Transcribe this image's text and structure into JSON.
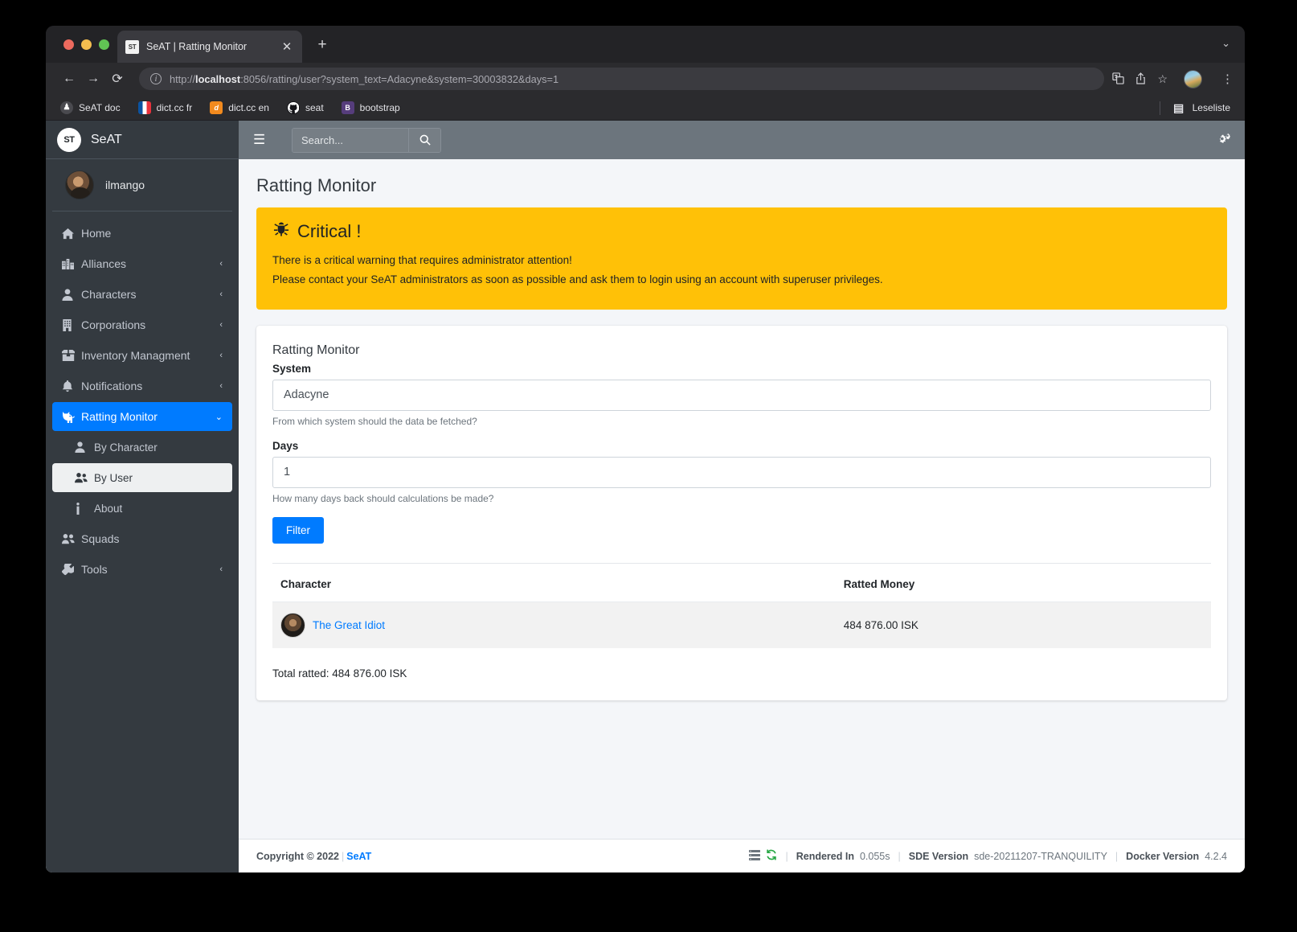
{
  "browser": {
    "tab": {
      "title": "SeAT | Ratting Monitor",
      "favicon_text": "ST",
      "close_icon": "✕"
    },
    "new_tab_icon": "+",
    "tab_menu_icon": "⌄",
    "back_icon": "←",
    "forward_icon": "→",
    "reload_icon": "⟳",
    "url_prefix": "http://",
    "url_host": "localhost",
    "url_rest": ":8056/ratting/user?system_text=Adacyne&system=30003832&days=1",
    "info_icon": "i",
    "translate_icon": "translate-icon",
    "share_icon": "⇪",
    "bookmark_icon": "☆",
    "kebab_icon": "⋮",
    "bookmarks": [
      {
        "label": "SeAT doc",
        "icon": "seat-icon",
        "glyph": "♟"
      },
      {
        "label": "dict.cc fr",
        "icon": "flag-fr-icon",
        "glyph": ""
      },
      {
        "label": "dict.cc en",
        "icon": "dict-icon",
        "glyph": "d"
      },
      {
        "label": "seat",
        "icon": "github-icon",
        "glyph": "◍"
      },
      {
        "label": "bootstrap",
        "icon": "bootstrap-icon",
        "glyph": "B"
      }
    ],
    "reading_list": {
      "label": "Leseliste",
      "icon": "reading-list-icon",
      "glyph": "▤"
    }
  },
  "sidebar": {
    "brand": {
      "logo_text": "ST",
      "name": "SeAT"
    },
    "user": {
      "name": "ilmango"
    },
    "items": [
      {
        "label": "Home",
        "icon": "home-icon",
        "glyph": "⌂",
        "arrow": "",
        "state": ""
      },
      {
        "label": "Alliances",
        "icon": "alliances-icon",
        "glyph": "🏙",
        "arrow": "‹",
        "state": ""
      },
      {
        "label": "Characters",
        "icon": "character-icon",
        "glyph": "👤",
        "arrow": "‹",
        "state": ""
      },
      {
        "label": "Corporations",
        "icon": "corporation-icon",
        "glyph": "🏢",
        "arrow": "‹",
        "state": ""
      },
      {
        "label": "Inventory Managment",
        "icon": "inventory-icon",
        "glyph": "📦",
        "arrow": "‹",
        "state": ""
      },
      {
        "label": "Notifications",
        "icon": "bell-icon",
        "glyph": "🔔",
        "arrow": "‹",
        "state": ""
      },
      {
        "label": "Ratting Monitor",
        "icon": "cat-icon",
        "glyph": "🐱",
        "arrow": "⌄",
        "state": "active"
      },
      {
        "label": "By Character",
        "icon": "user-icon",
        "glyph": "👤",
        "arrow": "",
        "state": "sub"
      },
      {
        "label": "By User",
        "icon": "users-icon",
        "glyph": "👥",
        "arrow": "",
        "state": "sub selected"
      },
      {
        "label": "About",
        "icon": "info-icon",
        "glyph": "ℹ",
        "arrow": "",
        "state": "sub"
      },
      {
        "label": "Squads",
        "icon": "squads-icon",
        "glyph": "👥",
        "arrow": "",
        "state": ""
      },
      {
        "label": "Tools",
        "icon": "wrench-icon",
        "glyph": "🔧",
        "arrow": "‹",
        "state": ""
      }
    ]
  },
  "navbar": {
    "hamburger_icon": "☰",
    "search_placeholder": "Search...",
    "search_value": "",
    "search_button_icon": "search-icon",
    "settings_icon": "cogs-icon"
  },
  "page": {
    "title": "Ratting Monitor"
  },
  "alert": {
    "icon": "bug-icon",
    "heading": "Critical !",
    "line1": "There is a critical warning that requires administrator attention!",
    "line2": "Please contact your SeAT administrators as soon as possible and ask them to login using an account with superuser privileges.",
    "color": "#ffc107"
  },
  "form": {
    "card_title": "Ratting Monitor",
    "system_label": "System",
    "system_value": "Adacyne",
    "system_help": "From which system should the data be fetched?",
    "days_label": "Days",
    "days_value": "1",
    "days_help": "How many days back should calculations be made?",
    "filter_button": "Filter"
  },
  "table": {
    "columns": [
      "Character",
      "Ratted Money"
    ],
    "rows": [
      {
        "character": "The Great Idiot",
        "ratted_money": "484 876.00 ISK"
      }
    ],
    "total": "Total ratted: 484 876.00 ISK"
  },
  "footer": {
    "copyright": "Copyright © 2022",
    "brand": "SeAT",
    "db_icon": "database-icon",
    "sync_icon": "sync-icon",
    "rendered_label": "Rendered In",
    "rendered_value": "0.055s",
    "sde_label": "SDE Version",
    "sde_value": "sde-20211207-TRANQUILITY",
    "docker_label": "Docker Version",
    "docker_value": "4.2.4"
  }
}
